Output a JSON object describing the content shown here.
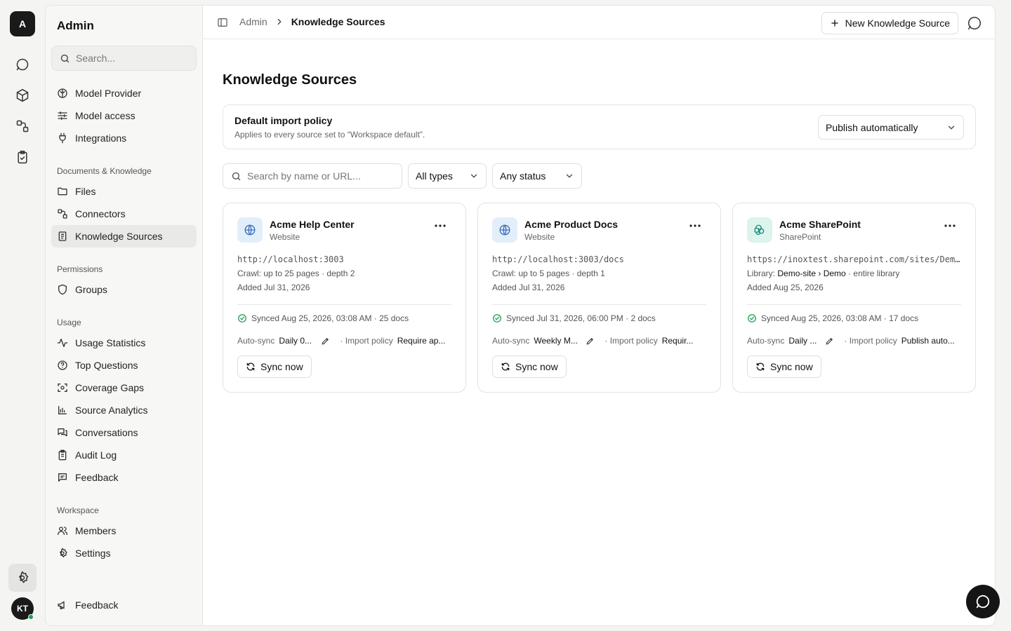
{
  "rail": {
    "workspace_initial": "A",
    "avatar_initials": "KT"
  },
  "sidebar": {
    "title": "Admin",
    "search_placeholder": "Search...",
    "items_top": [
      {
        "label": "Model Provider",
        "icon": "brain-icon"
      },
      {
        "label": "Model access",
        "icon": "sliders-icon"
      },
      {
        "label": "Integrations",
        "icon": "plug-icon"
      }
    ],
    "sections": [
      {
        "label": "Documents & Knowledge",
        "items": [
          {
            "label": "Files",
            "icon": "folder-icon"
          },
          {
            "label": "Connectors",
            "icon": "connector-icon"
          },
          {
            "label": "Knowledge Sources",
            "icon": "book-icon",
            "active": true
          }
        ]
      },
      {
        "label": "Permissions",
        "items": [
          {
            "label": "Groups",
            "icon": "shield-icon"
          }
        ]
      },
      {
        "label": "Usage",
        "items": [
          {
            "label": "Usage Statistics",
            "icon": "activity-icon"
          },
          {
            "label": "Top Questions",
            "icon": "question-icon"
          },
          {
            "label": "Coverage Gaps",
            "icon": "scan-icon"
          },
          {
            "label": "Source Analytics",
            "icon": "bar-chart-icon"
          },
          {
            "label": "Conversations",
            "icon": "chat-icon"
          },
          {
            "label": "Audit Log",
            "icon": "clipboard-icon"
          },
          {
            "label": "Feedback",
            "icon": "message-square-icon"
          }
        ]
      },
      {
        "label": "Workspace",
        "items": [
          {
            "label": "Members",
            "icon": "users-icon"
          },
          {
            "label": "Settings",
            "icon": "gear-icon"
          }
        ]
      }
    ],
    "footer_feedback": "Feedback"
  },
  "topbar": {
    "breadcrumb_root": "Admin",
    "breadcrumb_current": "Knowledge Sources",
    "new_button": "New Knowledge Source"
  },
  "page": {
    "title": "Knowledge Sources",
    "policy": {
      "title": "Default import policy",
      "subtitle": "Applies to every source set to “Workspace default”.",
      "value": "Publish automatically"
    },
    "filters": {
      "search_placeholder": "Search by name or URL...",
      "type": "All types",
      "status": "Any status"
    }
  },
  "cards": [
    {
      "name": "Acme Help Center",
      "kind": "Website",
      "url": "http://localhost:3003",
      "line1": "Crawl: up to 25 pages · depth 2",
      "added": "Added Jul 31, 2026",
      "synced": "Synced Aug 25, 2026, 03:08 AM · 25 docs",
      "autosync_label": "Auto-sync",
      "autosync_value": "Daily 0...",
      "import_label": "· Import policy",
      "import_value": "Require ap...",
      "sync_button": "Sync now"
    },
    {
      "name": "Acme Product Docs",
      "kind": "Website",
      "url": "http://localhost:3003/docs",
      "line1": "Crawl: up to 5 pages · depth 1",
      "added": "Added Jul 31, 2026",
      "synced": "Synced Jul 31, 2026, 06:00 PM · 2 docs",
      "autosync_label": "Auto-sync",
      "autosync_value": "Weekly M...",
      "import_label": "· Import policy",
      "import_value": "Requir...",
      "sync_button": "Sync now"
    },
    {
      "name": "Acme SharePoint",
      "kind": "SharePoint",
      "url": "https://inoxtest.sharepoint.com/sites/Dem...",
      "line1_prefix": "Library:",
      "line1_strong": "Demo-site › Demo",
      "line1_suffix": "· entire library",
      "added": "Added Aug 25, 2026",
      "synced": "Synced Aug 25, 2026, 03:08 AM · 17 docs",
      "autosync_label": "Auto-sync",
      "autosync_value": "Daily ...",
      "import_label": "· Import policy",
      "import_value": "Publish auto...",
      "sync_button": "Sync now"
    }
  ]
}
